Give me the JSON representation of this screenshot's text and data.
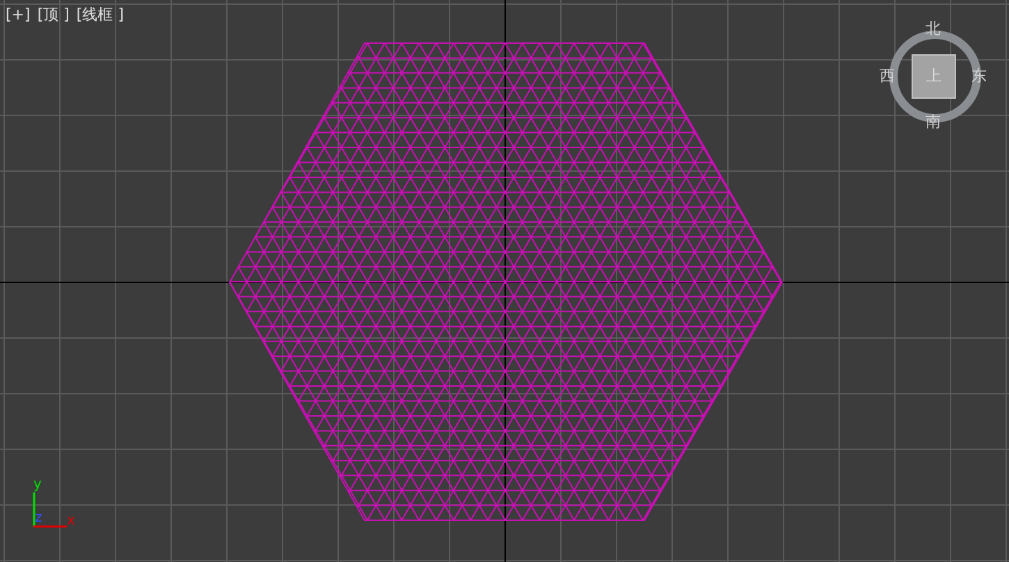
{
  "viewport_labels": [
    {
      "text": "[+]"
    },
    {
      "text": "[顶 ]"
    },
    {
      "text": "[线框 ]"
    }
  ],
  "viewcube": {
    "north": "北",
    "west": "西",
    "east": "东",
    "south": "南",
    "face": "上"
  },
  "axis_gizmo": {
    "x": "x",
    "y": "y",
    "z": "z"
  }
}
